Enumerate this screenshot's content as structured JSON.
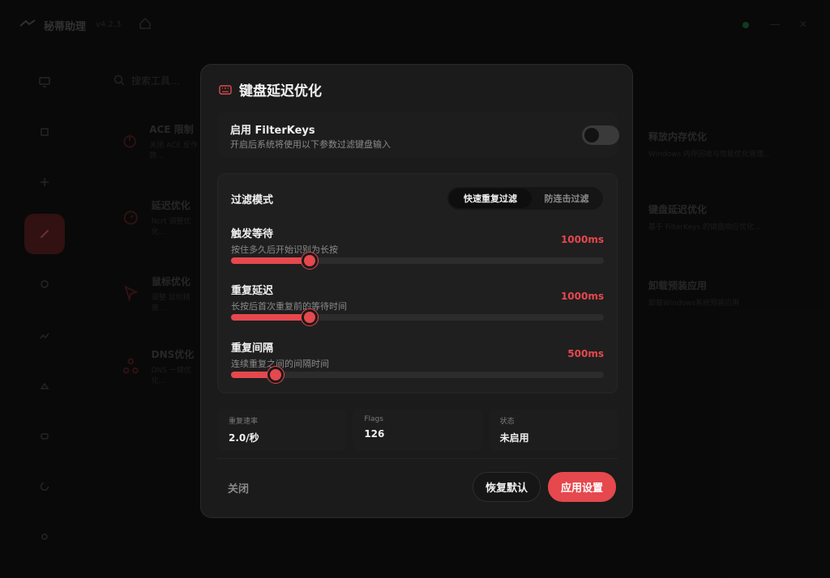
{
  "app": {
    "title": "秘蒂助理",
    "version": "v4.2.3",
    "search_placeholder": "搜索工具…",
    "sidebar_icons": [
      "monitor-icon",
      "chip-icon",
      "cpu-icon",
      "wrench-icon",
      "shield-icon",
      "network-icon",
      "cloud-icon",
      "gamepad-icon",
      "refresh-icon",
      "settings-icon"
    ],
    "tools_left": [
      {
        "name": "ACE 限制",
        "desc": "关闭 ACE 反作弊…",
        "icon": "power-icon"
      },
      {
        "name": "延迟优化",
        "desc": "Ncrt 调整优化…",
        "icon": "timer-icon"
      },
      {
        "name": "鼠标优化",
        "desc": "调整 鼠标精度…",
        "icon": "cursor-icon"
      },
      {
        "name": "DNS优化",
        "desc": "DNS 一键优化…",
        "icon": "network-icon"
      }
    ],
    "tools_right": [
      {
        "name": "释放内存优化",
        "desc": "Windows 内存回收与性能优化管理…"
      },
      {
        "name": "键盘延迟优化",
        "desc": "基于 FilterKeys 的键盘响应优化…"
      },
      {
        "name": "卸载预装应用",
        "desc": "卸载Windows系统预装应用"
      }
    ]
  },
  "modal": {
    "title": "键盘延迟优化",
    "enable": {
      "title": "启用 FilterKeys",
      "desc": "开启后系统将使用以下参数过滤键盘输入",
      "on": false
    },
    "filter": {
      "label": "过滤模式",
      "modes": [
        "快速重复过滤",
        "防连击过滤"
      ],
      "selected": 0
    },
    "sliders": [
      {
        "title": "触发等待",
        "desc": "按住多久后开始识别为长按",
        "value_text": "1000ms",
        "fraction": 0.21
      },
      {
        "title": "重复延迟",
        "desc": "长按后首次重复前的等待时间",
        "value_text": "1000ms",
        "fraction": 0.21
      },
      {
        "title": "重复间隔",
        "desc": "连续重复之间的间隔时间",
        "value_text": "500ms",
        "fraction": 0.12
      }
    ],
    "stats": [
      {
        "label": "重复速率",
        "value": "2.0/秒"
      },
      {
        "label": "Flags",
        "value": "126"
      },
      {
        "label": "状态",
        "value": "未启用"
      }
    ],
    "buttons": {
      "close": "关闭",
      "reset": "恢复默认",
      "apply": "应用设置"
    }
  },
  "colors": {
    "accent": "#e5484d",
    "background": "#121212",
    "modal": "#1b1b1b"
  }
}
